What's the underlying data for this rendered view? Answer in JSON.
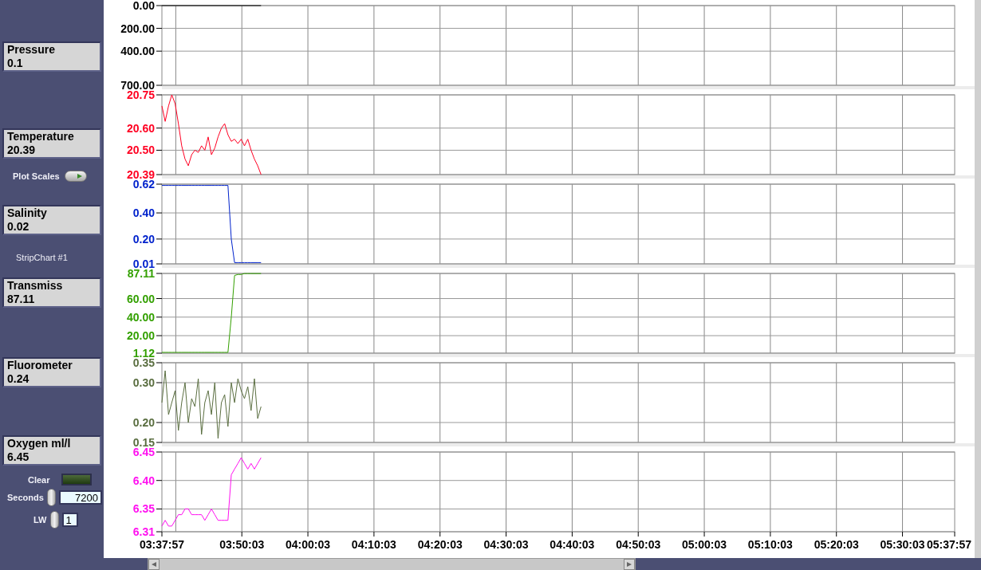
{
  "indicators": [
    {
      "label": "Pressure",
      "value": "0.1"
    },
    {
      "label": "Temperature",
      "value": "20.39"
    },
    {
      "label": "Salinity",
      "value": "0.02"
    },
    {
      "label": "Transmiss",
      "value": "87.11"
    },
    {
      "label": "Fluorometer",
      "value": "0.24"
    },
    {
      "label": "Oxygen ml/l",
      "value": "6.45"
    }
  ],
  "plot_scales": {
    "label": "Plot Scales",
    "on": false
  },
  "chart_name": "StripChart #1",
  "clear": {
    "label": "Clear",
    "on": false
  },
  "seconds": {
    "label": "Seconds",
    "value": "7200"
  },
  "line_width": {
    "label": "LW",
    "value": "1"
  },
  "charts": [
    {
      "chart_data": {
        "type": "line",
        "grid": true,
        "xlim": [
          13077,
          20277
        ],
        "ylim": [
          700,
          0
        ],
        "yticks": [
          {
            "value": 0,
            "label": "0.00"
          },
          {
            "value": 200,
            "label": "200.00"
          },
          {
            "value": 400,
            "label": "400.00"
          },
          {
            "value": 700,
            "label": "700.00"
          }
        ],
        "x": [
          13077,
          13977
        ],
        "series": [
          {
            "color": "#000000",
            "values": [
              0,
              0
            ]
          }
        ]
      }
    },
    {
      "chart_data": {
        "type": "line",
        "grid": true,
        "xlim": [
          13077,
          20277
        ],
        "ylim": [
          20.39,
          20.75
        ],
        "yticks": [
          {
            "value": 20.75,
            "label": "20.75"
          },
          {
            "value": 20.6,
            "label": "20.60"
          },
          {
            "value": 20.5,
            "label": "20.50"
          },
          {
            "value": 20.39,
            "label": "20.39"
          }
        ],
        "x": [
          13077,
          13107,
          13137,
          13167,
          13197,
          13227,
          13257,
          13287,
          13317,
          13347,
          13377,
          13407,
          13437,
          13467,
          13497,
          13527,
          13557,
          13587,
          13617,
          13647,
          13677,
          13707,
          13737,
          13767,
          13797,
          13827,
          13857,
          13887,
          13917,
          13947,
          13977
        ],
        "series": [
          {
            "color": "#ff0022",
            "values": [
              20.7,
              20.63,
              20.7,
              20.75,
              20.71,
              20.62,
              20.52,
              20.46,
              20.43,
              20.48,
              20.5,
              20.49,
              20.52,
              20.5,
              20.56,
              20.48,
              20.51,
              20.56,
              20.6,
              20.62,
              20.57,
              20.54,
              20.55,
              20.53,
              20.55,
              20.52,
              20.55,
              20.5,
              20.46,
              20.43,
              20.39
            ]
          }
        ]
      }
    },
    {
      "chart_data": {
        "type": "line",
        "grid": true,
        "xlim": [
          13077,
          20277
        ],
        "ylim": [
          0.01,
          0.62
        ],
        "yticks": [
          {
            "value": 0.62,
            "label": "0.62"
          },
          {
            "value": 0.4,
            "label": "0.40"
          },
          {
            "value": 0.2,
            "label": "0.20"
          },
          {
            "value": 0.01,
            "label": "0.01"
          }
        ],
        "x": [
          13077,
          13107,
          13137,
          13167,
          13197,
          13227,
          13257,
          13287,
          13317,
          13347,
          13377,
          13407,
          13437,
          13467,
          13497,
          13527,
          13557,
          13587,
          13617,
          13647,
          13677,
          13707,
          13737,
          13767,
          13797,
          13827,
          13857,
          13887,
          13917,
          13947,
          13977
        ],
        "series": [
          {
            "color": "#0022cc",
            "values": [
              0.61,
              0.61,
              0.61,
              0.61,
              0.61,
              0.61,
              0.61,
              0.61,
              0.61,
              0.61,
              0.61,
              0.61,
              0.61,
              0.61,
              0.61,
              0.61,
              0.61,
              0.61,
              0.61,
              0.61,
              0.61,
              0.2,
              0.02,
              0.02,
              0.02,
              0.02,
              0.02,
              0.02,
              0.02,
              0.02,
              0.02
            ]
          }
        ]
      }
    },
    {
      "chart_data": {
        "type": "line",
        "grid": true,
        "xlim": [
          13077,
          20277
        ],
        "ylim": [
          1.12,
          87.11
        ],
        "yticks": [
          {
            "value": 87.11,
            "label": "87.11"
          },
          {
            "value": 60,
            "label": "60.00"
          },
          {
            "value": 40,
            "label": "40.00"
          },
          {
            "value": 20,
            "label": "20.00"
          },
          {
            "value": 1.12,
            "label": "1.12"
          }
        ],
        "x": [
          13077,
          13107,
          13137,
          13167,
          13197,
          13227,
          13257,
          13287,
          13317,
          13347,
          13377,
          13407,
          13437,
          13467,
          13497,
          13527,
          13557,
          13587,
          13617,
          13647,
          13677,
          13707,
          13737,
          13767,
          13797,
          13827,
          13857,
          13887,
          13917,
          13947,
          13977
        ],
        "series": [
          {
            "color": "#33a000",
            "values": [
              2,
              2,
              2,
              2,
              2,
              2,
              2,
              2,
              2,
              2,
              2,
              2,
              2,
              2,
              2,
              2,
              2,
              2,
              2,
              2,
              2,
              40,
              85,
              86,
              86,
              87,
              87,
              87,
              87,
              87,
              87
            ]
          }
        ]
      }
    },
    {
      "chart_data": {
        "type": "line",
        "grid": true,
        "xlim": [
          13077,
          20277
        ],
        "ylim": [
          0.15,
          0.35
        ],
        "yticks": [
          {
            "value": 0.35,
            "label": "0.35"
          },
          {
            "value": 0.3,
            "label": "0.30"
          },
          {
            "value": 0.2,
            "label": "0.20"
          },
          {
            "value": 0.15,
            "label": "0.15"
          }
        ],
        "x": [
          13077,
          13107,
          13137,
          13167,
          13197,
          13227,
          13257,
          13287,
          13317,
          13347,
          13377,
          13407,
          13437,
          13467,
          13497,
          13527,
          13557,
          13587,
          13617,
          13647,
          13677,
          13707,
          13737,
          13767,
          13797,
          13827,
          13857,
          13887,
          13917,
          13947,
          13977
        ],
        "series": [
          {
            "color": "#5a6e40",
            "values": [
              0.25,
              0.33,
              0.22,
              0.25,
              0.28,
              0.18,
              0.25,
              0.3,
              0.2,
              0.26,
              0.24,
              0.31,
              0.17,
              0.25,
              0.28,
              0.22,
              0.3,
              0.16,
              0.25,
              0.27,
              0.19,
              0.3,
              0.25,
              0.31,
              0.28,
              0.26,
              0.29,
              0.23,
              0.31,
              0.21,
              0.24
            ]
          }
        ]
      }
    },
    {
      "chart_data": {
        "type": "line",
        "grid": true,
        "xlim": [
          13077,
          20277
        ],
        "xticks": [
          {
            "value": 13077,
            "label": "03:37:57"
          },
          {
            "value": 13803,
            "label": "03:50:03"
          },
          {
            "value": 14403,
            "label": "04:00:03"
          },
          {
            "value": 15003,
            "label": "04:10:03"
          },
          {
            "value": 15603,
            "label": "04:20:03"
          },
          {
            "value": 16203,
            "label": "04:30:03"
          },
          {
            "value": 16803,
            "label": "04:40:03"
          },
          {
            "value": 17403,
            "label": "04:50:03"
          },
          {
            "value": 18003,
            "label": "05:00:03"
          },
          {
            "value": 18603,
            "label": "05:10:03"
          },
          {
            "value": 19203,
            "label": "05:20:03"
          },
          {
            "value": 19803,
            "label": "05:30:03"
          },
          {
            "value": 20277,
            "label": "05:37:57"
          }
        ],
        "ylim": [
          6.31,
          6.45
        ],
        "yticks": [
          {
            "value": 6.45,
            "label": "6.45"
          },
          {
            "value": 6.4,
            "label": "6.40"
          },
          {
            "value": 6.35,
            "label": "6.35"
          },
          {
            "value": 6.31,
            "label": "6.31"
          }
        ],
        "x": [
          13077,
          13107,
          13137,
          13167,
          13197,
          13227,
          13257,
          13287,
          13317,
          13347,
          13377,
          13407,
          13437,
          13467,
          13497,
          13527,
          13557,
          13587,
          13617,
          13647,
          13677,
          13707,
          13737,
          13767,
          13797,
          13827,
          13857,
          13887,
          13917,
          13947,
          13977
        ],
        "series": [
          {
            "color": "#ff10f0",
            "values": [
              6.32,
              6.33,
              6.32,
              6.32,
              6.33,
              6.34,
              6.34,
              6.35,
              6.35,
              6.34,
              6.34,
              6.34,
              6.34,
              6.33,
              6.34,
              6.35,
              6.34,
              6.33,
              6.33,
              6.33,
              6.33,
              6.41,
              6.42,
              6.43,
              6.44,
              6.43,
              6.42,
              6.43,
              6.42,
              6.43,
              6.44
            ]
          }
        ]
      }
    }
  ]
}
